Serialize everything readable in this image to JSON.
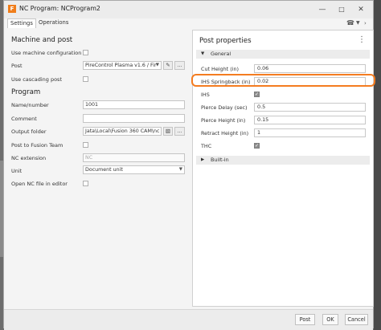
{
  "window": {
    "title": "NC Program: NCProgram2",
    "app_icon": "F"
  },
  "tabs": [
    {
      "label": "Settings"
    },
    {
      "label": "Operations"
    }
  ],
  "left": {
    "machine_section": "Machine and post",
    "use_machine_config": {
      "label": "Use machine configuration",
      "checked": false
    },
    "post": {
      "label": "Post",
      "value": "PireControl Plasma v1.6 / Fir",
      "more": "..."
    },
    "use_cascading_post": {
      "label": "Use cascading post",
      "checked": false
    },
    "program_section": "Program",
    "name_number": {
      "label": "Name/number",
      "value": "1001"
    },
    "comment": {
      "label": "Comment",
      "value": ""
    },
    "output_folder": {
      "label": "Output folder",
      "value": "Jata\\Local\\Fusion 360 CAM\\nc",
      "more": "..."
    },
    "post_to_fusion_team": {
      "label": "Post to Fusion Team",
      "checked": false
    },
    "nc_extension": {
      "label": "NC extension",
      "placeholder": "NC"
    },
    "unit": {
      "label": "Unit",
      "value": "Document unit"
    },
    "open_nc_file": {
      "label": "Open NC file in editor",
      "checked": false
    }
  },
  "right": {
    "title": "Post properties",
    "general_group": "General",
    "properties": [
      {
        "label": "Cut Height (in)",
        "value": "0.06"
      },
      {
        "label": "IHS Springback (in)",
        "value": "0.02"
      },
      {
        "label": "IHS",
        "checked": true
      },
      {
        "label": "Pierce Delay (sec)",
        "value": "0.5"
      },
      {
        "label": "Pierce Height (in)",
        "value": "0.15"
      },
      {
        "label": "Retract Height (in)",
        "value": "1"
      },
      {
        "label": "THC",
        "checked": true
      }
    ],
    "builtin_group": "Built-in"
  },
  "footer": {
    "post": "Post",
    "ok": "OK",
    "cancel": "Cancel"
  },
  "colors": {
    "highlight": "#f47c20",
    "app_icon": "#f07d1a"
  }
}
